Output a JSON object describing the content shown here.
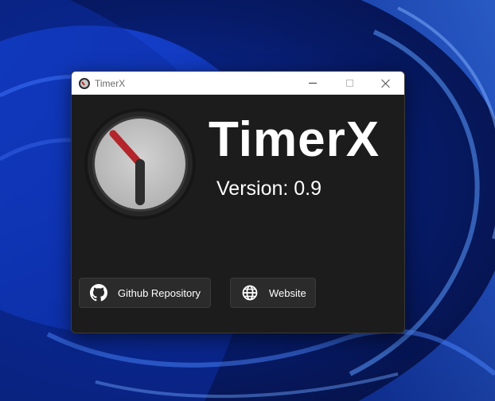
{
  "window": {
    "title": "TimerX"
  },
  "app": {
    "name": "TimerX",
    "version_text": "Version: 0.9"
  },
  "buttons": {
    "github_label": "Github Repository",
    "website_label": "Website"
  },
  "icons": {
    "app": "clock-icon",
    "github": "github-icon",
    "website": "globe-icon",
    "minimize": "minimize-icon",
    "maximize": "maximize-icon",
    "close": "close-icon"
  },
  "colors": {
    "window_bg": "#1c1c1c",
    "titlebar_bg": "#ffffff",
    "button_bg": "#2b2b2b",
    "clock_face": "#c4c4c4",
    "clock_hand_red": "#b3252a",
    "clock_hand_dark": "#2e2e2e",
    "desktop_blue": "#0a2488"
  }
}
